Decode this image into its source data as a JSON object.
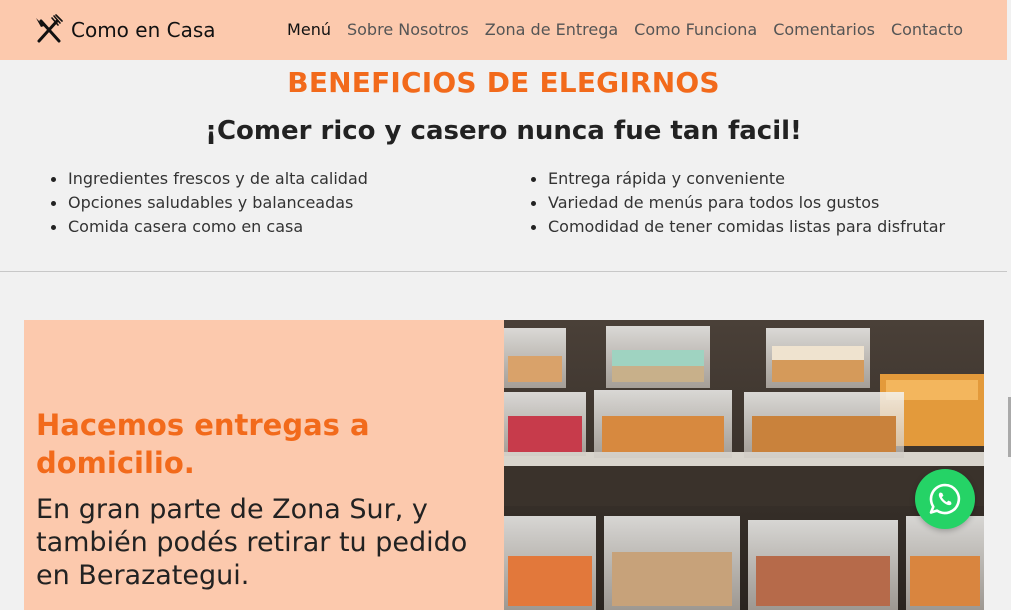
{
  "header": {
    "brand": "Como en Casa",
    "brand_icon": "fork-knife-icon",
    "nav": [
      "Menú",
      "Sobre Nosotros",
      "Zona de Entrega",
      "Como Funciona",
      "Comentarios",
      "Contacto"
    ]
  },
  "benefits": {
    "title": "BENEFICIOS DE ELEGIRNOS",
    "subtitle": "¡Comer rico y casero nunca fue tan facil!",
    "left": [
      "Ingredientes frescos y de alta calidad",
      "Opciones saludables y balanceadas",
      "Comida casera como en casa"
    ],
    "right": [
      "Entrega rápida y conveniente",
      "Variedad de menús para todos los gustos",
      "Comodidad de tener comidas listas para disfrutar"
    ]
  },
  "delivery": {
    "title": "Hacemos entregas a domicilio.",
    "text": "En gran parte de Zona Sur, y también podés retirar tu pedido en Berazategui."
  },
  "whatsapp": {
    "icon": "whatsapp-icon"
  },
  "colors": {
    "accent": "#f26a1b",
    "peach": "#fcc9ad",
    "background": "#f1f1f1",
    "whatsapp": "#25d366"
  }
}
